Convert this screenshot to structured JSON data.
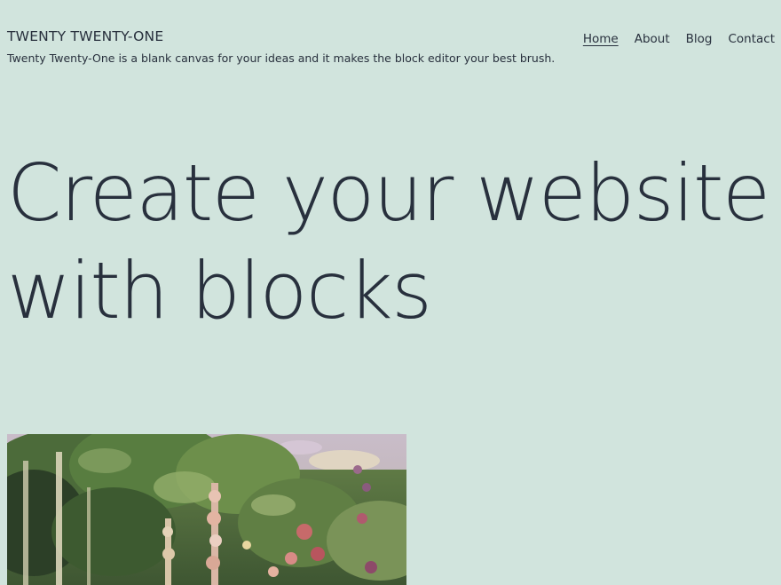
{
  "site": {
    "title": "TWENTY TWENTY-ONE",
    "description": "Twenty Twenty-One is a blank canvas for your ideas and it makes the block editor your best brush."
  },
  "nav": {
    "items": [
      {
        "label": "Home",
        "current": true
      },
      {
        "label": "About"
      },
      {
        "label": "Blog"
      },
      {
        "label": "Contact"
      }
    ]
  },
  "hero": {
    "heading_line1": "Create your website",
    "heading_line2": "with blocks"
  },
  "colors": {
    "background": "#d1e4dd",
    "text": "#28303d"
  }
}
